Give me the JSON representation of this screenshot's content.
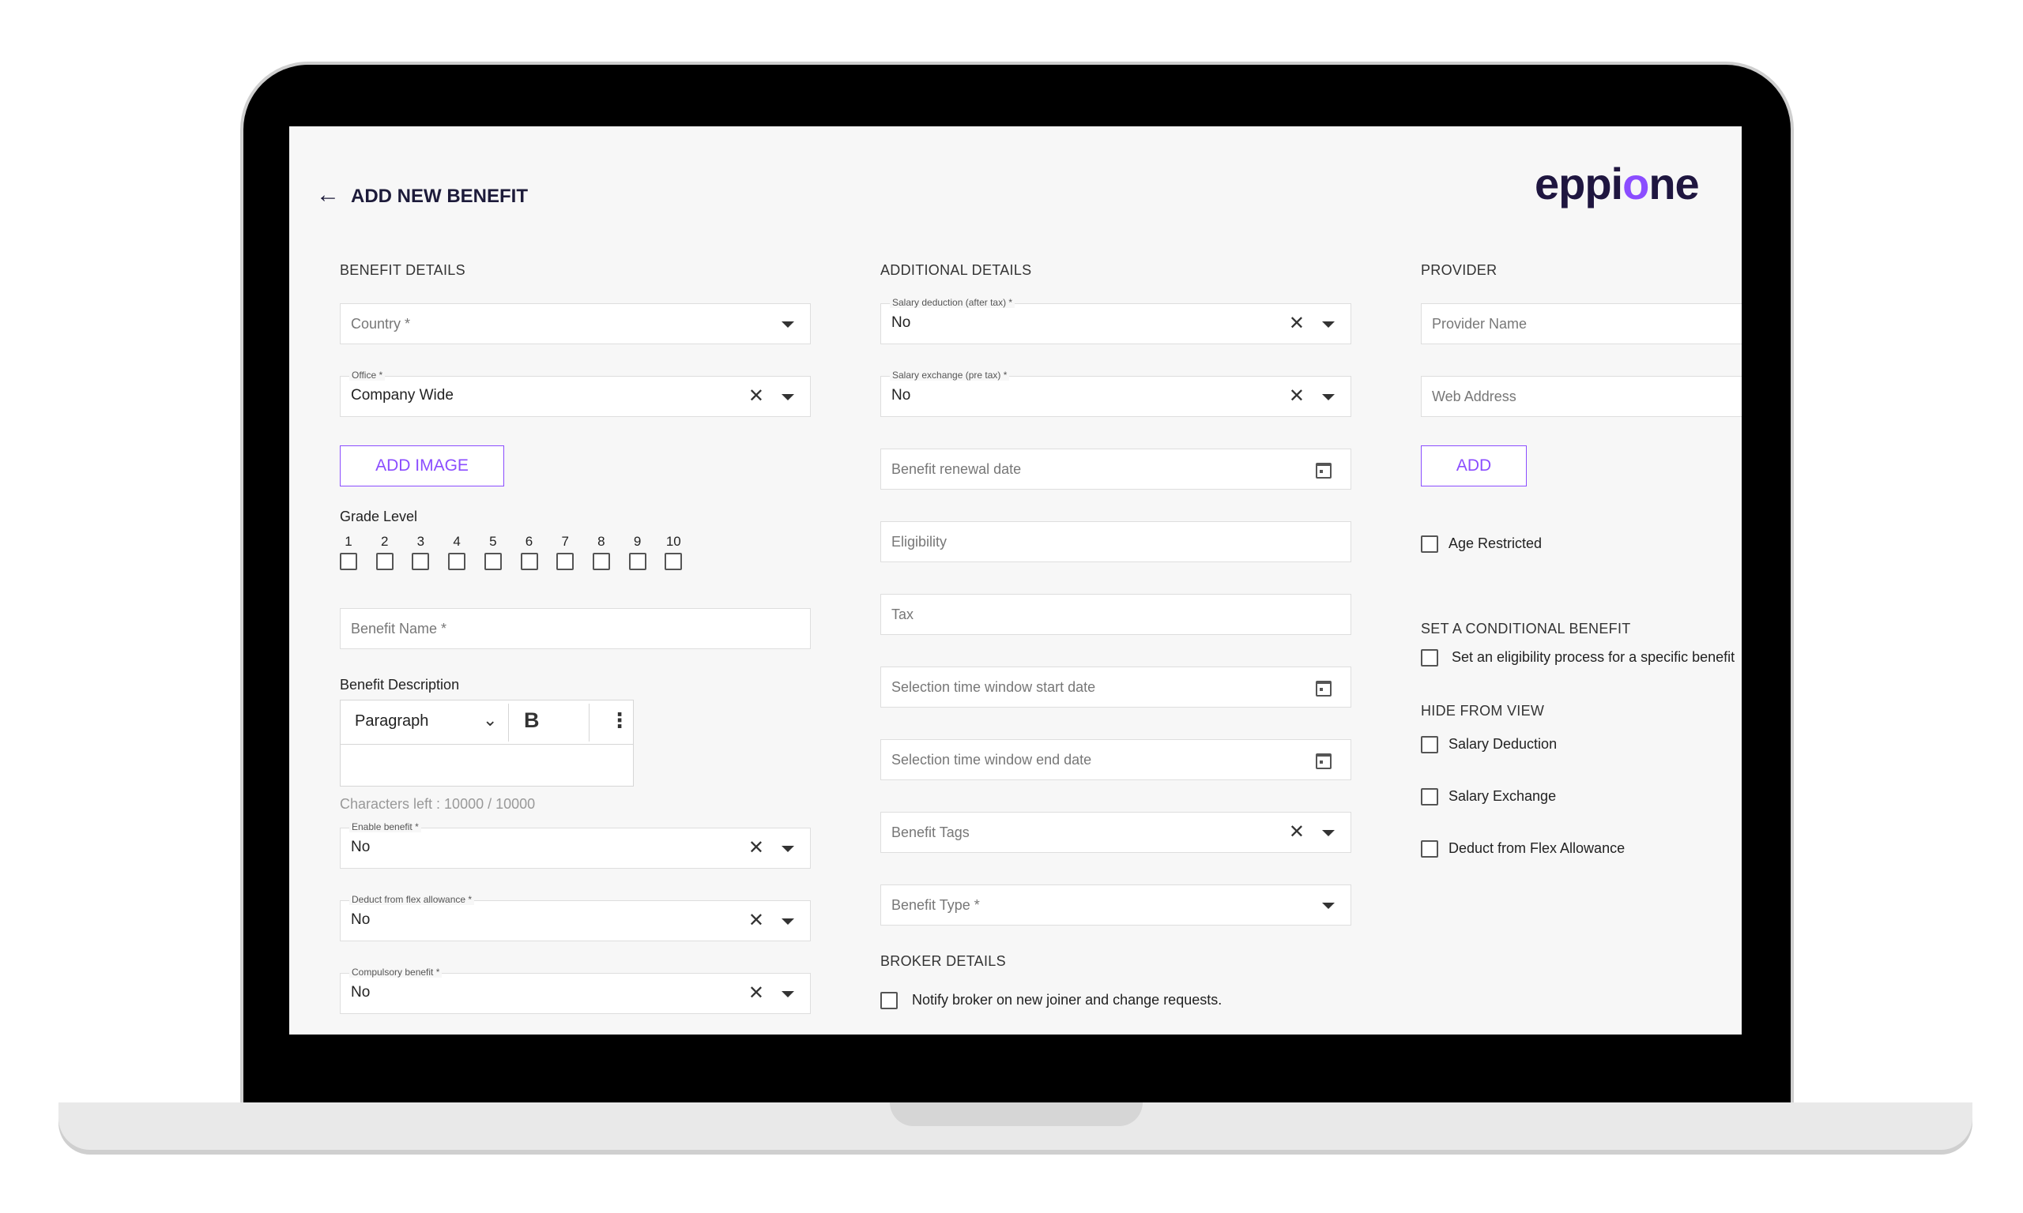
{
  "header": {
    "title": "ADD NEW BENEFIT",
    "back_icon": "arrow-left-icon"
  },
  "logo": {
    "part1": "eppi",
    "part2": "o",
    "part3": "ne"
  },
  "benefit_details": {
    "title": "BENEFIT DETAILS",
    "country_placeholder": "Country *",
    "office_label": "Office *",
    "office_value": "Company Wide",
    "add_image": "ADD IMAGE",
    "grade_level_label": "Grade Level",
    "grades": [
      "1",
      "2",
      "3",
      "4",
      "5",
      "6",
      "7",
      "8",
      "9",
      "10"
    ],
    "benefit_name_placeholder": "Benefit Name *",
    "description_label": "Benefit Description",
    "editor_style": "Paragraph",
    "editor_bold": "B",
    "chars_left": "Characters left : 10000 / 10000",
    "enable_label": "Enable benefit *",
    "enable_value": "No",
    "flex_label": "Deduct from flex allowance *",
    "flex_value": "No",
    "compulsory_label": "Compulsory benefit *",
    "compulsory_value": "No"
  },
  "additional_details": {
    "title": "ADDITIONAL DETAILS",
    "salary_deduction_label": "Salary deduction (after tax) *",
    "salary_deduction_value": "No",
    "salary_exchange_label": "Salary exchange (pre tax) *",
    "salary_exchange_value": "No",
    "renewal_placeholder": "Benefit renewal date",
    "eligibility_placeholder": "Eligibility",
    "tax_placeholder": "Tax",
    "window_start_placeholder": "Selection time window start date",
    "window_end_placeholder": "Selection time window end date",
    "tags_placeholder": "Benefit Tags",
    "type_placeholder": "Benefit Type *"
  },
  "broker": {
    "title": "BROKER DETAILS",
    "notify_label": "Notify broker on new joiner and change requests."
  },
  "provider": {
    "title": "PROVIDER",
    "name_placeholder": "Provider Name",
    "web_placeholder": "Web Address",
    "add_button": "ADD",
    "age_restricted": "Age Restricted"
  },
  "conditional": {
    "title": "SET A CONDITIONAL BENEFIT",
    "option": "Set an eligibility process for a specific benefit"
  },
  "hide_from_view": {
    "title": "HIDE FROM VIEW",
    "options": [
      "Salary Deduction",
      "Salary Exchange",
      "Deduct from Flex Allowance"
    ]
  }
}
